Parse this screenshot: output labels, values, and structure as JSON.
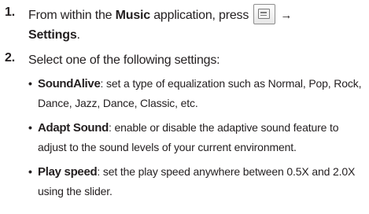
{
  "steps": [
    {
      "number": "1.",
      "prefix": "From within the ",
      "app_name": "Music",
      "middle": " application, press ",
      "menu_key_icon": "menu-key-icon",
      "arrow": "→",
      "target": "Settings",
      "suffix": "."
    },
    {
      "number": "2.",
      "text": "Select one of the following settings:"
    }
  ],
  "bullets": [
    {
      "marker": "•",
      "term": "SoundAlive",
      "description": ": set a type of equalization such as Normal, Pop, Rock, Dance, Jazz, Dance, Classic, etc."
    },
    {
      "marker": "•",
      "term": "Adapt Sound",
      "description": ": enable or disable the adaptive sound feature to adjust to the sound levels of your current environment."
    },
    {
      "marker": "•",
      "term": "Play speed",
      "description": ": set the play speed anywhere between 0.5X and 2.0X using the slider."
    }
  ]
}
